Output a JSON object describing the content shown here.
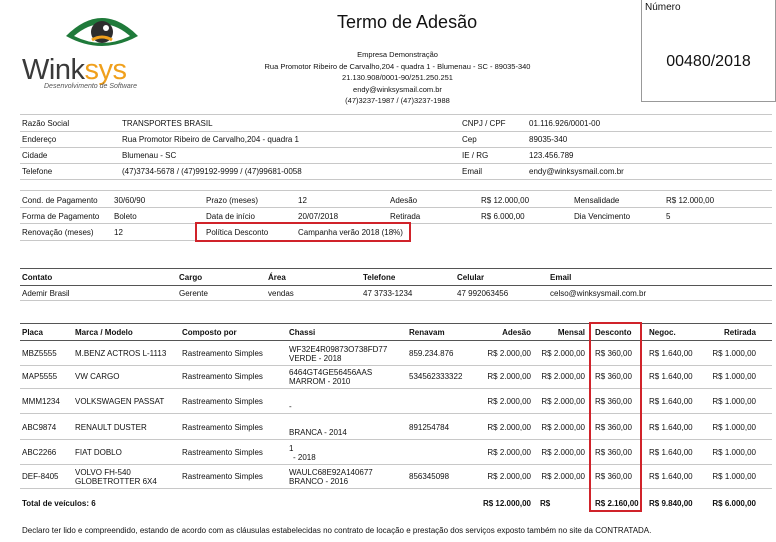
{
  "logo": {
    "word_main": "Wink",
    "word_accent": "sys",
    "tagline": "Desenvolvimento de Software",
    "accent_color": "#f0a01c",
    "eye_color": "#1f7a3a"
  },
  "header": {
    "title": "Termo de Adesão",
    "company_name": "Empresa Demonstração",
    "address": "Rua Promotor Ribeiro de Carvalho,204 - quadra 1 - Blumenau - SC - 89035-340",
    "cnpj": "21.130.908/0001-90/251.250.251",
    "email": "endy@winksysmail.com.br",
    "phones": "(47)3237-1987 / (47)3237-1988",
    "number_label": "Número",
    "number_value": "00480/2018"
  },
  "client": {
    "razao_label": "Razão Social",
    "razao_value": "TRANSPORTES BRASIL",
    "cnpj_label": "CNPJ / CPF",
    "cnpj_value": "01.116.926/0001-00",
    "endereco_label": "Endereço",
    "endereco_value": "Rua Promotor Ribeiro de Carvalho,204 - quadra 1",
    "cep_label": "Cep",
    "cep_value": "89035-340",
    "cidade_label": "Cidade",
    "cidade_value": "Blumenau - SC",
    "ie_label": "IE / RG",
    "ie_value": "123.456.789",
    "telefone_label": "Telefone",
    "telefone_value": "(47)3734-5678 / (47)99192-9999 / (47)99681-0058",
    "email_label": "Email",
    "email_value": "endy@winksysmail.com.br"
  },
  "contract": {
    "cond_label": "Cond. de Pagamento",
    "cond_value": "30/60/90",
    "prazo_label": "Prazo (meses)",
    "prazo_value": "12",
    "adesao_label": "Adesão",
    "adesao_value": "R$ 12.000,00",
    "mensalidade_label": "Mensalidade",
    "mensalidade_value": "R$ 12.000,00",
    "forma_label": "Forma de Pagamento",
    "forma_value": "Boleto",
    "inicio_label": "Data de início",
    "inicio_value": "20/07/2018",
    "retirada_label": "Retirada",
    "retirada_value": "R$ 6.000,00",
    "vencimento_label": "Dia Vencimento",
    "vencimento_value": "5",
    "renovacao_label": "Renovação (meses)",
    "renovacao_value": "12",
    "politica_label": "Política Desconto",
    "politica_value": "Campanha verão 2018 (18%)"
  },
  "contact": {
    "headers": {
      "contato": "Contato",
      "cargo": "Cargo",
      "area": "Área",
      "telefone": "Telefone",
      "celular": "Celular",
      "email": "Email"
    },
    "row": {
      "contato": "Ademir Brasil",
      "cargo": "Gerente",
      "area": "vendas",
      "telefone": "47 3733-1234",
      "celular": "47 992063456",
      "email": "celso@winksysmail.com.br"
    }
  },
  "vehicles": {
    "headers": {
      "placa": "Placa",
      "marca": "Marca / Modelo",
      "composto": "Composto por",
      "chassi": "Chassi",
      "renavam": "Renavam",
      "adesao": "Adesão",
      "mensal": "Mensal",
      "desconto": "Desconto",
      "negoc": "Negoc.",
      "retirada": "Retirada"
    },
    "rows": [
      {
        "placa": "MBZ5555",
        "marca1": "M.BENZ ACTROS L-1113",
        "marca2": "",
        "composto": "Rastreamento Simples",
        "chassi1": "WF32E4R09873O738FD77",
        "chassi2": "VERDE - 2018",
        "renavam": "859.234.876",
        "adesao": "R$ 2.000,00",
        "mensal": "R$ 2.000,00",
        "desconto": "R$ 360,00",
        "negoc": "R$ 1.640,00",
        "retirada": "R$ 1.000,00"
      },
      {
        "placa": "MAP5555",
        "marca1": "VW CARGO",
        "marca2": "",
        "composto": "Rastreamento Simples",
        "chassi1": "6464GT4GE56456AAS",
        "chassi2": "MARROM - 2010",
        "renavam": "534562333322",
        "adesao": "R$ 2.000,00",
        "mensal": "R$ 2.000,00",
        "desconto": "R$ 360,00",
        "negoc": "R$ 1.640,00",
        "retirada": "R$ 1.000,00"
      },
      {
        "placa": "MMM1234",
        "marca1": "VOLKSWAGEN PASSAT",
        "marca2": "",
        "composto": "Rastreamento Simples",
        "chassi1": "",
        "chassi2": "-",
        "renavam": "",
        "adesao": "R$ 2.000,00",
        "mensal": "R$ 2.000,00",
        "desconto": "R$ 360,00",
        "negoc": "R$ 1.640,00",
        "retirada": "R$ 1.000,00"
      },
      {
        "placa": "ABC9874",
        "marca1": "RENAULT DUSTER",
        "marca2": "",
        "composto": "Rastreamento Simples",
        "chassi1": "",
        "chassi2": "BRANCA - 2014",
        "renavam": "891254784",
        "adesao": "R$ 2.000,00",
        "mensal": "R$ 2.000,00",
        "desconto": "R$ 360,00",
        "negoc": "R$ 1.640,00",
        "retirada": "R$ 1.000,00"
      },
      {
        "placa": "ABC2266",
        "marca1": "FIAT DOBLO",
        "marca2": "",
        "composto": "Rastreamento Simples",
        "chassi1": "1",
        "chassi2": "- 2018",
        "renavam": "",
        "adesao": "R$ 2.000,00",
        "mensal": "R$ 2.000,00",
        "desconto": "R$ 360,00",
        "negoc": "R$ 1.640,00",
        "retirada": "R$ 1.000,00"
      },
      {
        "placa": "DEF-8405",
        "marca1": "VOLVO FH-540",
        "marca2": "GLOBETROTTER 6X4",
        "composto": "Rastreamento Simples",
        "chassi1": "WAULC68E92A140677",
        "chassi2": "BRANCO - 2016",
        "renavam": "856345098",
        "adesao": "R$ 2.000,00",
        "mensal": "R$ 2.000,00",
        "desconto": "R$ 360,00",
        "negoc": "R$ 1.640,00",
        "retirada": "R$ 1.000,00"
      }
    ],
    "total": {
      "label": "Total de veículos: 6",
      "adesao": "R$ 12.000,00",
      "mensal": "R$",
      "desconto": "R$ 2.160,00",
      "negoc": "R$ 9.840,00",
      "retirada": "R$ 6.000,00"
    }
  },
  "footer": {
    "declaration": "Declaro ter lido e compreendido, estando de acordo com as cláusulas estabelecidas no contrato de locação e prestação dos serviços exposto também no site da CONTRATADA."
  }
}
